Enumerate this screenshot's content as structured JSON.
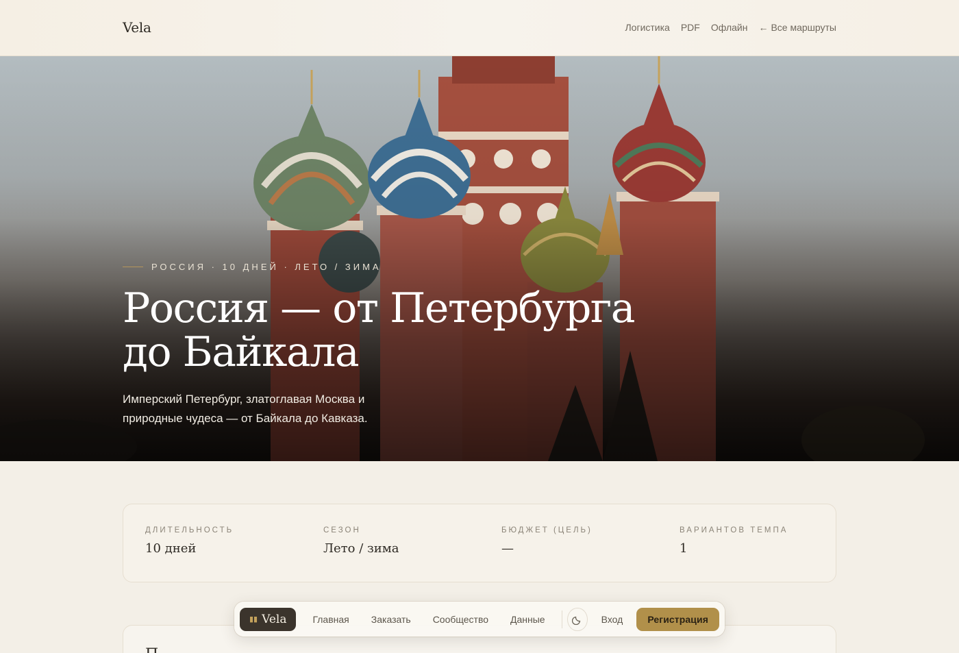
{
  "header": {
    "brand": "Vela",
    "nav": [
      {
        "label": "Логистика"
      },
      {
        "label": "PDF"
      },
      {
        "label": "Офлайн"
      }
    ],
    "back_label": "Все маршруты"
  },
  "hero": {
    "eyebrow": "РОССИЯ · 10 ДНЕЙ · ЛЕТО / ЗИМА",
    "title": "Россия — от Петербурга до Байкала",
    "subtitle": "Имперский Петербург, златоглавая Москва и природные чудеса — от Байкала до Кавказа.",
    "image": "St. Basil's Cathedral domes"
  },
  "stats": [
    {
      "label": "ДЛИТЕЛЬНОСТЬ",
      "value": "10 дней"
    },
    {
      "label": "СЕЗОН",
      "value": "Лето / зима"
    },
    {
      "label": "БЮДЖЕТ (ЦЕЛЬ)",
      "value": "—"
    },
    {
      "label": "ВАРИАНТОВ ТЕМПА",
      "value": "1"
    }
  ],
  "next_section": {
    "peek_text": "П"
  },
  "dock": {
    "brand": "Vela",
    "links": [
      {
        "label": "Главная"
      },
      {
        "label": "Заказать"
      },
      {
        "label": "Сообщество"
      },
      {
        "label": "Данные"
      }
    ],
    "login": "Вход",
    "signup": "Регистрация"
  },
  "colors": {
    "accent": "#b1904a",
    "dark": "#3b342c",
    "background": "#f3efe7"
  },
  "icons": [
    "arrow-left-icon",
    "moon-icon",
    "vela-mark-icon"
  ]
}
